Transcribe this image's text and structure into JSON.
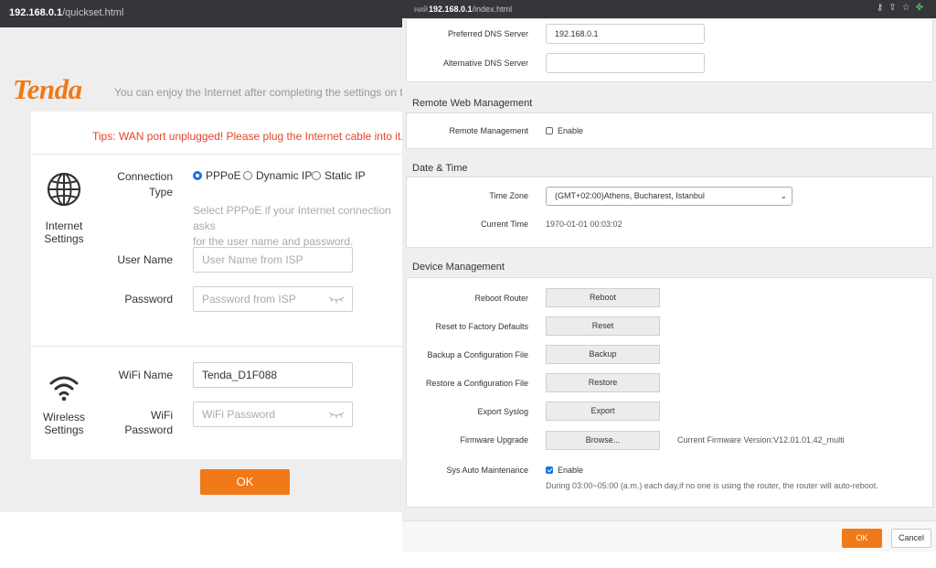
{
  "left": {
    "url_host": "192.168.0.1",
    "url_path": "/quickset.html",
    "logo": "Tenda",
    "slogan": "You can enjoy the Internet after completing the settings on this page.",
    "tips": "Tips: WAN port unplugged! Please plug the Internet cable into it.",
    "internet": {
      "section_line1": "Internet",
      "section_line2": "Settings",
      "connection_label_1": "Connection",
      "connection_label_2": "Type",
      "options": [
        "PPPoE",
        "Dynamic IP",
        "Static IP"
      ],
      "selected": "PPPoE",
      "hint_line1": "Select PPPoE if your Internet connection asks",
      "hint_line2": "for the user name and password.",
      "username_label": "User Name",
      "username_placeholder": "User Name from ISP",
      "password_label": "Password",
      "password_placeholder": "Password from ISP"
    },
    "wireless": {
      "section_line1": "Wireless",
      "section_line2": "Settings",
      "wifi_name_label": "WiFi Name",
      "wifi_name_value": "Tenda_D1F088",
      "wifi_password_label_1": "WiFi",
      "wifi_password_label_2": "Password",
      "wifi_password_placeholder": "WiFi Password"
    },
    "ok_label": "OK"
  },
  "right": {
    "tab_fragment": "ний",
    "url_host": "192.168.0.1",
    "url_path": "/index.html",
    "preferred_dns_label": "Preferred DNS Server",
    "preferred_dns_value": "192.168.0.1",
    "alternative_dns_label": "Alternative DNS Server",
    "alternative_dns_value": "",
    "remote": {
      "title": "Remote Web Management",
      "label": "Remote Management",
      "enable_label": "Enable",
      "enabled": false
    },
    "datetime": {
      "title": "Date & Time",
      "zone_label": "Time Zone",
      "zone_value": "(GMT+02:00)Athens, Bucharest, Istanbul",
      "current_label": "Current Time",
      "current_value": "1970-01-01 00:03:02"
    },
    "device": {
      "title": "Device Management",
      "rows": [
        {
          "label": "Reboot Router",
          "button": "Reboot"
        },
        {
          "label": "Reset to Factory Defaults",
          "button": "Reset"
        },
        {
          "label": "Backup a Configuration File",
          "button": "Backup"
        },
        {
          "label": "Restore a Configuration File",
          "button": "Restore"
        },
        {
          "label": "Export Syslog",
          "button": "Export"
        },
        {
          "label": "Firmware Upgrade",
          "button": "Browse..."
        }
      ],
      "firmware_version": "Current Firmware Version:V12.01.01.42_multi",
      "maintenance_label": "Sys Auto Maintenance",
      "maintenance_enable": "Enable",
      "maintenance_enabled": true,
      "maintenance_note": "During 03:00~05:00 (a.m.) each day,if no one is using the router, the router will auto-reboot."
    },
    "ok_label": "OK",
    "cancel_label": "Cancel"
  }
}
